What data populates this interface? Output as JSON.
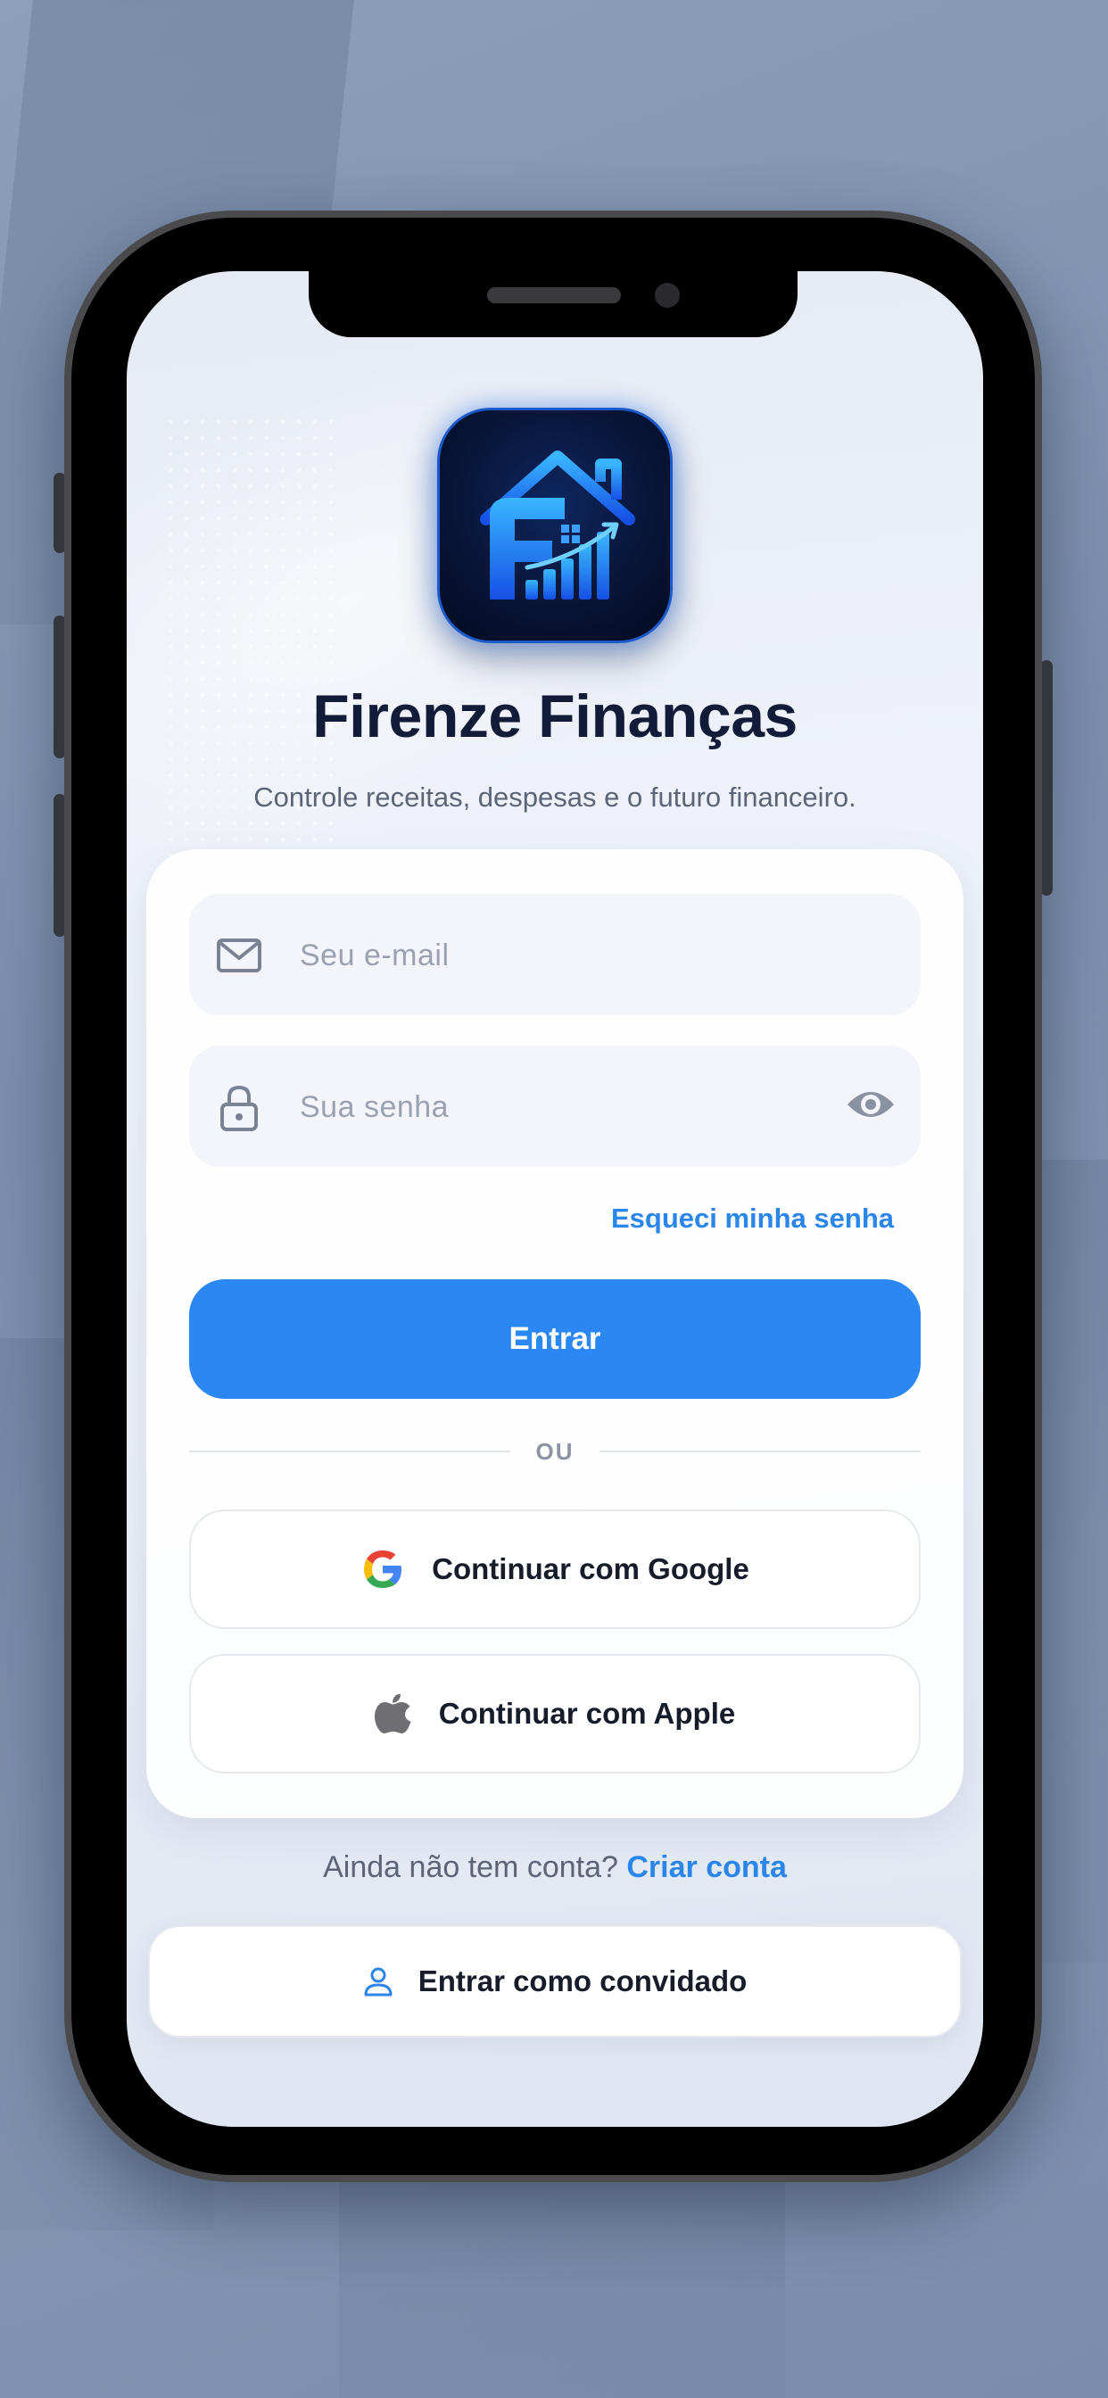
{
  "app": {
    "title": "Firenze Finanças",
    "subtitle": "Controle receitas, despesas e o futuro financeiro.",
    "logo_icon": "house-chart-logo-icon"
  },
  "login_form": {
    "email_placeholder": "Seu e-mail",
    "email_icon": "mail-icon",
    "password_placeholder": "Sua senha",
    "password_icon": "lock-icon",
    "toggle_visibility_icon": "eye-icon",
    "forgot_password_label": "Esqueci minha senha",
    "submit_label": "Entrar",
    "divider_label": "OU",
    "google_label": "Continuar com Google",
    "apple_label": "Continuar com Apple"
  },
  "signup": {
    "prompt": "Ainda não tem conta?",
    "link_label": "Criar conta"
  },
  "guest": {
    "label": "Entrar como convidado",
    "icon": "user-icon"
  },
  "colors": {
    "accent": "#2a87f4",
    "title": "#121c38",
    "muted": "#5b6577"
  }
}
